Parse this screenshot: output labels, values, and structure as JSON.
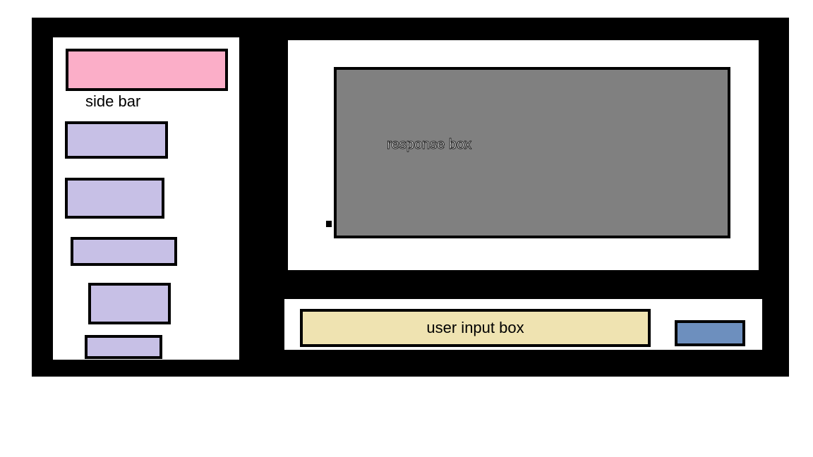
{
  "sidebar": {
    "label": "side bar",
    "header_color": "#fbaec8",
    "item_color": "#c7c0e6",
    "item_count": 5
  },
  "response": {
    "label": "response box",
    "color": "#808080"
  },
  "input": {
    "label": "user input box",
    "color": "#efe3b1",
    "send_button_color": "#6d8fbe"
  }
}
